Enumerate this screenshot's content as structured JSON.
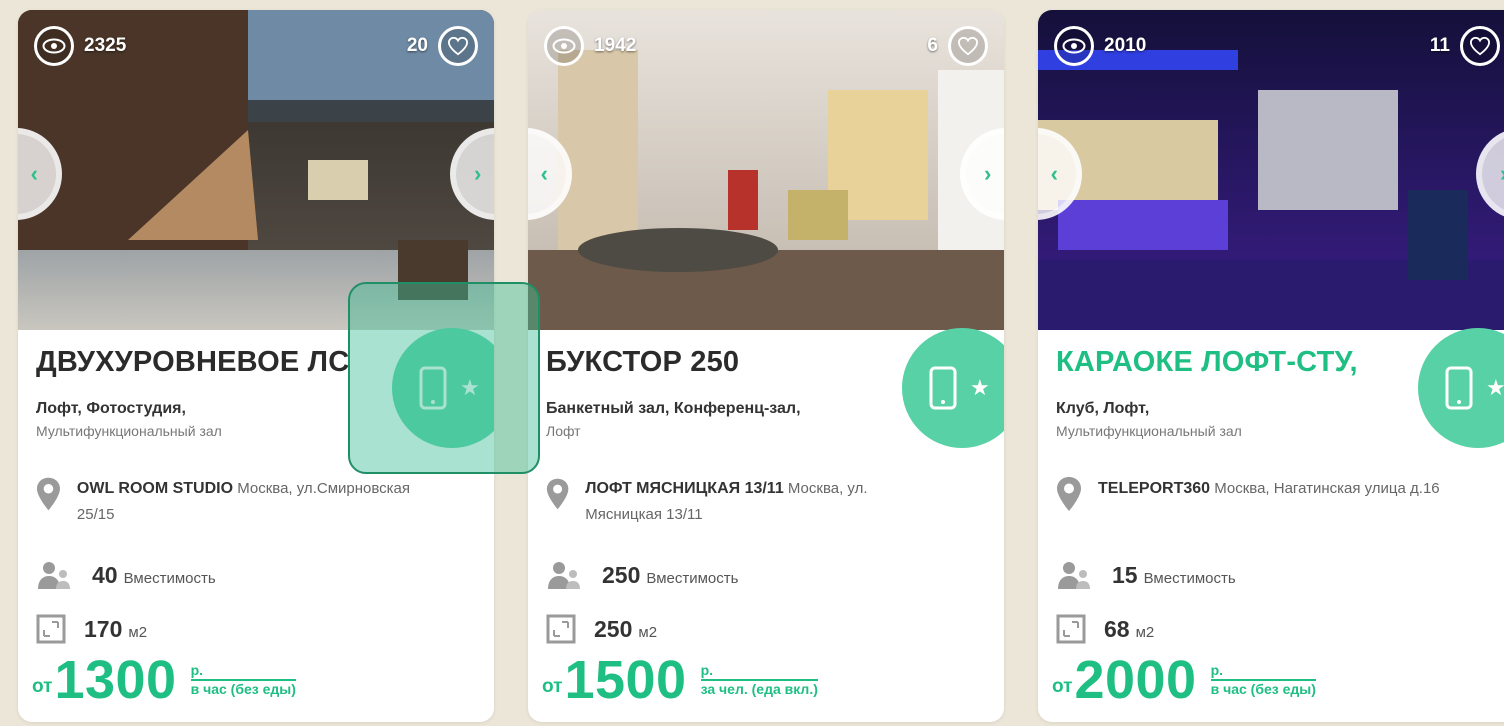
{
  "colors": {
    "accent": "#1fbf84",
    "badge": "#58d1a6",
    "background": "#ece6d8"
  },
  "icons": {
    "views": "eye-icon",
    "likes": "heart-icon",
    "prev": "chevron-left-icon",
    "next": "chevron-right-icon",
    "badge": "smartphone-icon",
    "star": "star-icon",
    "address": "map-pin-icon",
    "capacity": "people-icon",
    "area": "area-square-icon"
  },
  "cards": [
    {
      "views": "2325",
      "likes": "20",
      "title": "ДВУХУРОВНЕВОЕ ЛС",
      "categories_main": "Лофт, Фотостудия,",
      "categories_extra": "Мультифункциональный зал",
      "venue": "OWL ROOM STUDIO",
      "address": "Москва, ул.Смирновская 25/15",
      "capacity": "40",
      "capacity_label": "Вместимость",
      "area": "170",
      "area_unit": "м2",
      "price_from": "от",
      "price": "1300",
      "price_currency": "р.",
      "price_terms": "в час (без еды)"
    },
    {
      "views": "1942",
      "likes": "6",
      "title": "БУКСТОР 250",
      "categories_main": "Банкетный зал, Конференц-зал,",
      "categories_extra": "Лофт",
      "venue": "ЛОФТ МЯСНИЦКАЯ 13/11",
      "address": "Москва, ул. Мясницкая 13/11",
      "capacity": "250",
      "capacity_label": "Вместимость",
      "area": "250",
      "area_unit": "м2",
      "price_from": "от",
      "price": "1500",
      "price_currency": "р.",
      "price_terms": "за чел. (еда вкл.)"
    },
    {
      "views": "2010",
      "likes": "11",
      "title": "КАРАОКЕ ЛОФТ-СТУ,",
      "categories_main": "Клуб, Лофт,",
      "categories_extra": "Мультифункциональный зал",
      "venue": "TELEPORT360",
      "address": "Москва, Нагатинская улица д.16",
      "capacity": "15",
      "capacity_label": "Вместимость",
      "area": "68",
      "area_unit": "м2",
      "price_from": "от",
      "price": "2000",
      "price_currency": "р.",
      "price_terms": "в час (без еды)"
    }
  ]
}
